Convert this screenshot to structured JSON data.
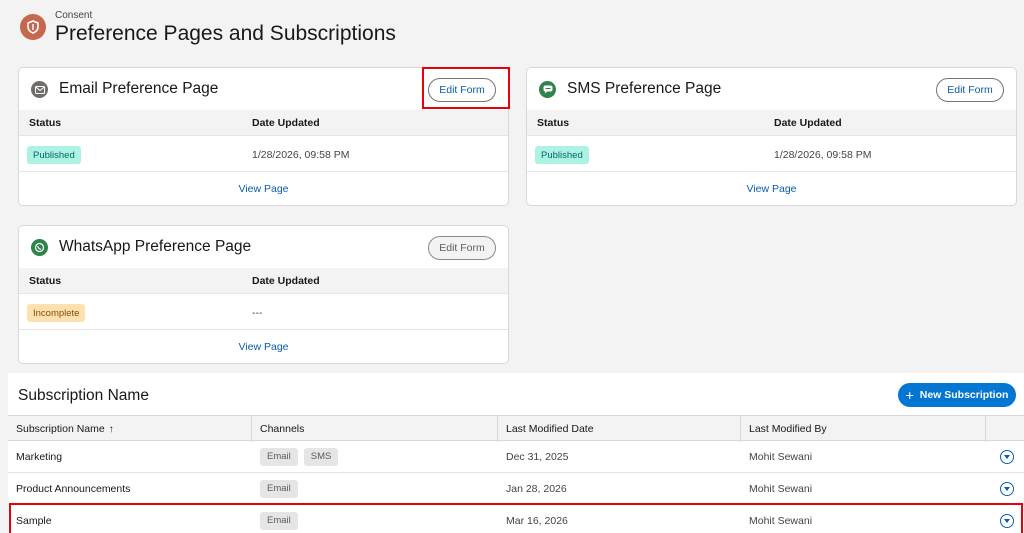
{
  "header": {
    "eyebrow": "Consent",
    "title": "Preference Pages and Subscriptions",
    "icon": "shield-icon",
    "icon_color": "#c6684f"
  },
  "cards": {
    "email": {
      "title": "Email Preference Page",
      "icon": "envelope-icon",
      "icon_color": "#706e6b",
      "edit_label": "Edit Form",
      "col_status": "Status",
      "col_date": "Date Updated",
      "status": "Published",
      "date": "1/28/2026, 09:58 PM",
      "view_label": "View Page"
    },
    "sms": {
      "title": "SMS Preference Page",
      "icon": "chat-bubble-icon",
      "icon_color": "#2e844a",
      "edit_label": "Edit Form",
      "col_status": "Status",
      "col_date": "Date Updated",
      "status": "Published",
      "date": "1/28/2026, 09:58 PM",
      "view_label": "View Page"
    },
    "whatsapp": {
      "title": "WhatsApp Preference Page",
      "icon": "whatsapp-icon",
      "icon_color": "#2e844a",
      "edit_label": "Edit Form",
      "col_status": "Status",
      "col_date": "Date Updated",
      "status": "Incomplete",
      "date": "---",
      "view_label": "View Page"
    }
  },
  "subscriptions": {
    "title": "Subscription Name",
    "new_label": "New Subscription",
    "columns": [
      "Subscription Name",
      "Channels",
      "Last Modified Date",
      "Last Modified By"
    ],
    "sort_indicator": "↑",
    "rows": [
      {
        "name": "Marketing",
        "channels": [
          "Email",
          "SMS"
        ],
        "date": "Dec 31, 2025",
        "by": "Mohit Sewani"
      },
      {
        "name": "Product Announcements",
        "channels": [
          "Email"
        ],
        "date": "Jan 28, 2026",
        "by": "Mohit Sewani"
      },
      {
        "name": "Sample",
        "channels": [
          "Email"
        ],
        "date": "Mar 16, 2026",
        "by": "Mohit Sewani"
      }
    ]
  },
  "colors": {
    "accent": "#0176d3",
    "link": "#0b5cab",
    "highlight": "#e8000b",
    "published_bg": "#acf3e4",
    "incomplete_bg": "#fde2b0"
  }
}
